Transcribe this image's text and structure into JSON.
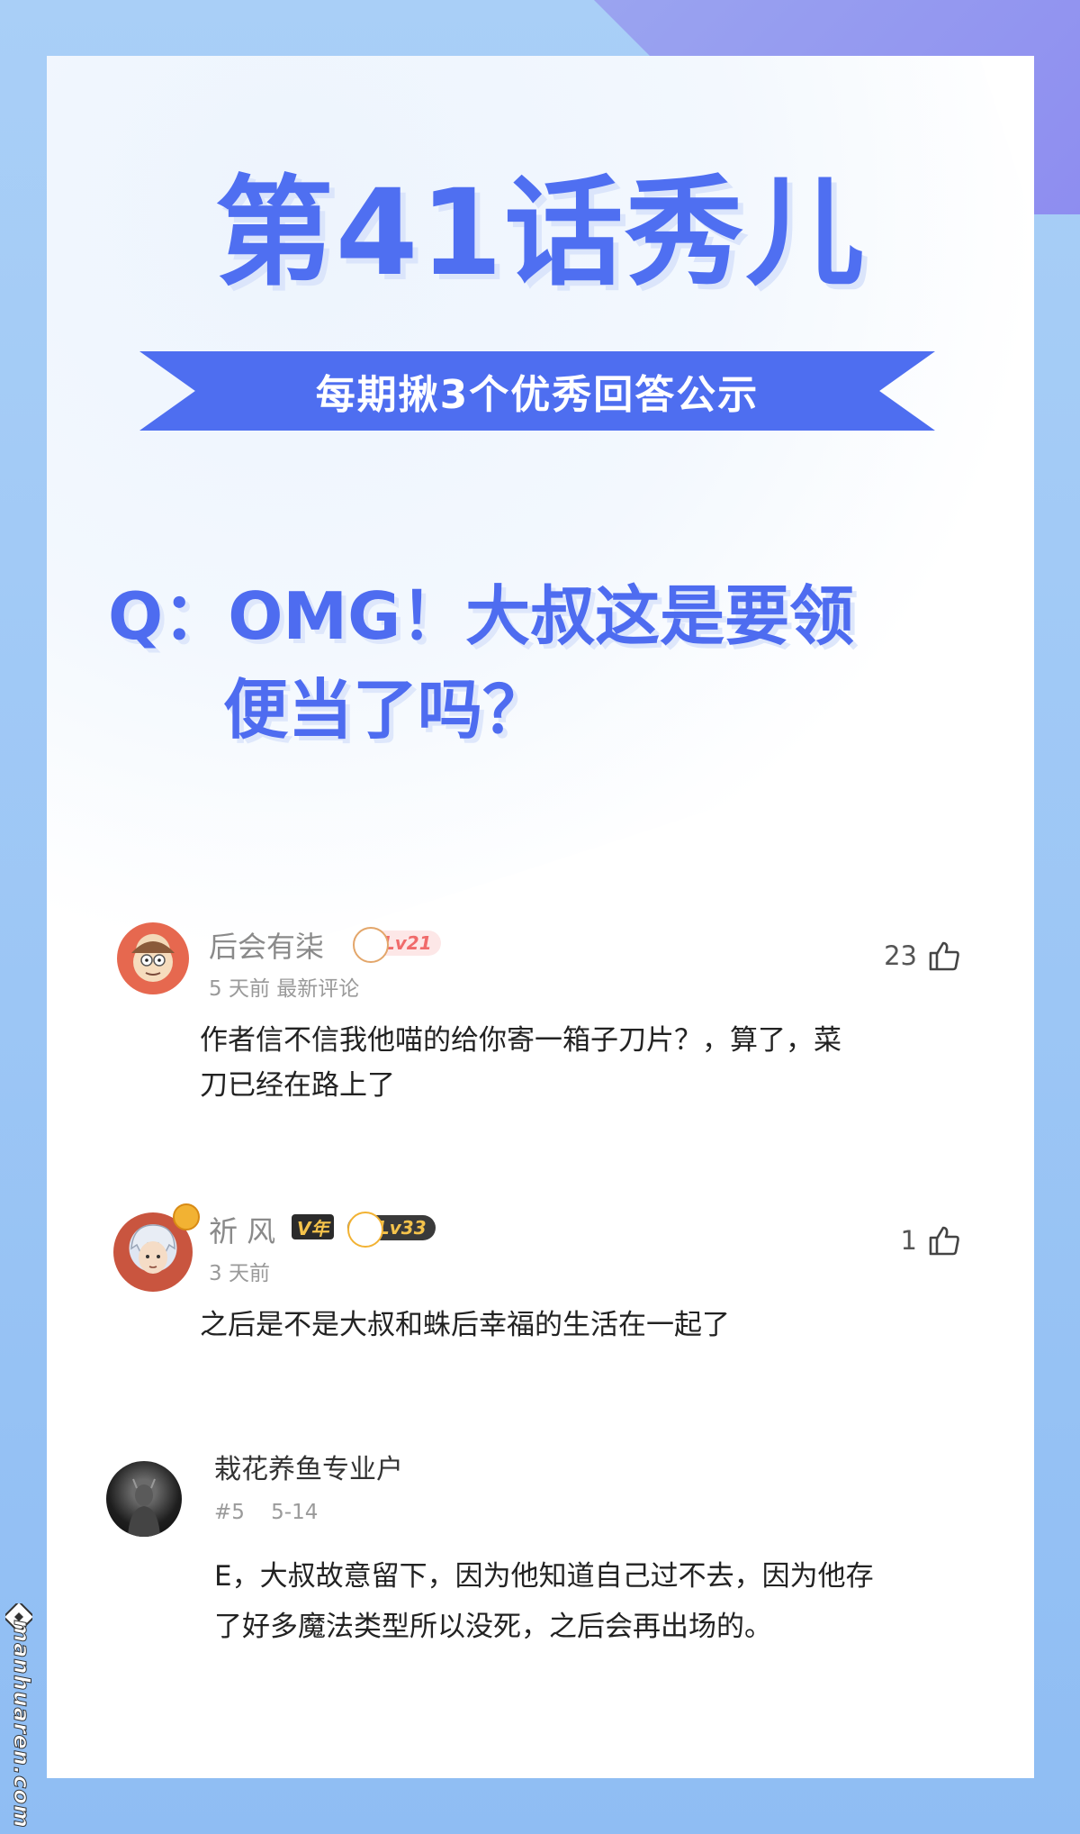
{
  "header": {
    "title": "第41话秀儿",
    "ribbon": "每期揪3个优秀回答公示"
  },
  "question": {
    "line1": "Q：OMG！大叔这是要领",
    "line2": "便当了吗？"
  },
  "comments": [
    {
      "username": "后会有柒",
      "level": "Lv21",
      "meta": "5 天前  最新评论",
      "likes": "23",
      "text_line1": "作者信不信我他喵的给你寄一箱子刀片？，算了，菜",
      "text_line2": "刀已经在路上了"
    },
    {
      "username": "祈 风",
      "vip": "V年",
      "level": "Lv33",
      "meta": "3 天前",
      "likes": "1",
      "text_line1": "之后是不是大叔和蛛后幸福的生活在一起了"
    },
    {
      "username": "栽花养鱼专业户",
      "meta": "#5    5-14",
      "text_line1": "E，大叔故意留下，因为他知道自己过不去，因为他存",
      "text_line2": "了好多魔法类型所以没死，之后会再出场的。"
    }
  ],
  "watermark": "manhuaren.com",
  "colors": {
    "brand_blue": "#4f6ff1",
    "background": "#a9cff7",
    "corner_purple": "#9aa4f0"
  }
}
